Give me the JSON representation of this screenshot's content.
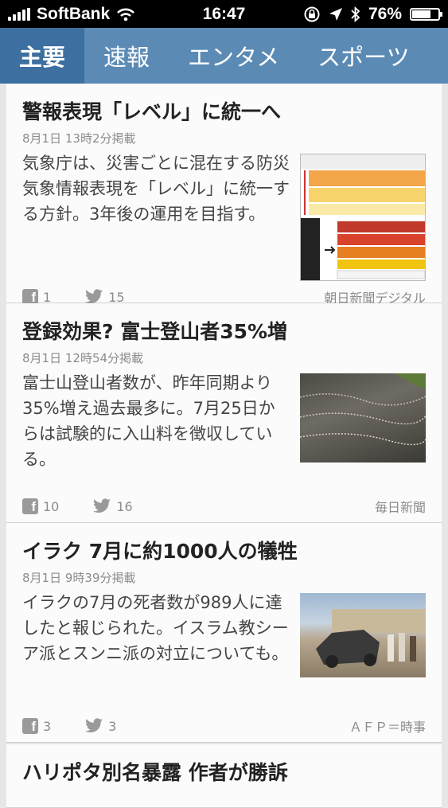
{
  "status": {
    "carrier": "SoftBank",
    "time": "16:47",
    "battery": "76%",
    "battery_level": 0.76
  },
  "tabs": [
    {
      "label": "主要",
      "active": true
    },
    {
      "label": "速報"
    },
    {
      "label": "エンタメ"
    },
    {
      "label": "スポーツ"
    }
  ],
  "articles": [
    {
      "title": "警報表現「レベル」に統一へ",
      "date": "8月1日 13時2分掲載",
      "summary": "気象庁は、災害ごとに混在する防災気象情報表現を「レベル」に統一する方針。3年後の運用を目指す。",
      "facebook": "1",
      "twitter": "15",
      "source": "朝日新聞デジタル"
    },
    {
      "title": "登録効果? 富士登山者35%増",
      "date": "8月1日 12時54分掲載",
      "summary": "富士山登山者数が、昨年同期より35%増え過去最多に。7月25日からは試験的に入山料を徴収している。",
      "facebook": "10",
      "twitter": "16",
      "source": "毎日新聞"
    },
    {
      "title": "イラク 7月に約1000人の犠牲",
      "date": "8月1日 9時39分掲載",
      "summary": "イラクの7月の死者数が989人に達したと報じられた。イスラム教シーア派とスンニ派の対立についても。",
      "facebook": "3",
      "twitter": "3",
      "source": "ＡＦＰ＝時事"
    },
    {
      "title": "ハリポタ別名暴露 作者が勝訴"
    }
  ],
  "colors": {
    "tab_bar": "#5b8bb5",
    "tab_active": "#3d6fa0"
  }
}
